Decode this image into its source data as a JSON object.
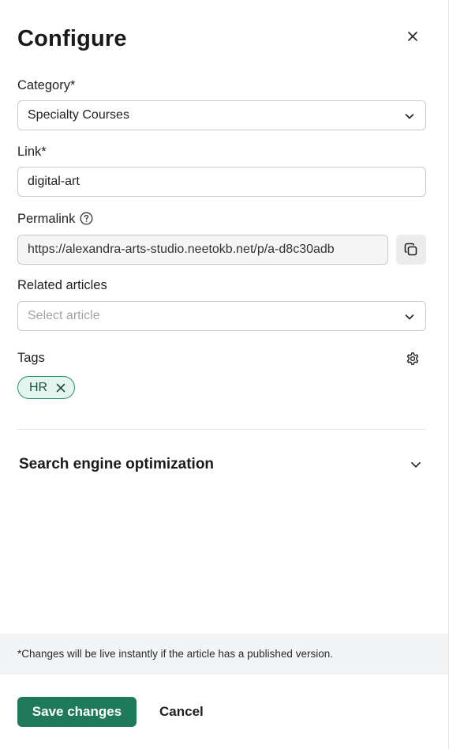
{
  "header": {
    "title": "Configure"
  },
  "category": {
    "label": "Category*",
    "value": "Specialty Courses"
  },
  "link": {
    "label": "Link*",
    "value": "digital-art"
  },
  "permalink": {
    "label": "Permalink",
    "value": "https://alexandra-arts-studio.neetokb.net/p/a-d8c30adb"
  },
  "related_articles": {
    "label": "Related articles",
    "placeholder": "Select article"
  },
  "tags": {
    "label": "Tags",
    "items": [
      {
        "label": "HR"
      }
    ]
  },
  "seo": {
    "title": "Search engine optimization"
  },
  "note": {
    "text": "*Changes will be live instantly if the article has a published version."
  },
  "footer": {
    "save_label": "Save changes",
    "cancel_label": "Cancel"
  },
  "colors": {
    "primary": "#1f7a5c",
    "tag_bg": "#e4f4ee",
    "tag_border": "#2f8f74",
    "note_bg": "#f3f4f6"
  },
  "icons": [
    "close-icon",
    "chevron-down-icon",
    "help-circle-icon",
    "copy-icon",
    "gear-icon",
    "remove-tag-icon"
  ]
}
